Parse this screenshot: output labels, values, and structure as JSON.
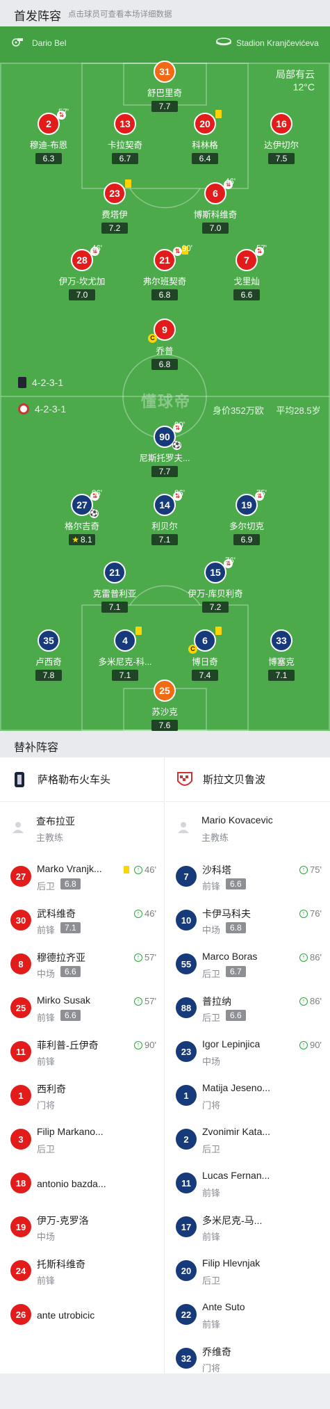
{
  "header": {
    "title": "首发阵容",
    "subtitle": "点击球员可查看本场详细数据"
  },
  "match": {
    "referee": "Dario Bel",
    "stadium": "Stadion Kranjčevićeva",
    "weather": "局部有云",
    "temperature": "12°C"
  },
  "home": {
    "formation": "4-2-3-1",
    "players": [
      {
        "num": "31",
        "name": "舒巴里奇",
        "rating": "7.7",
        "color": "orange"
      },
      {
        "num": "2",
        "name": "穆迪-布恩",
        "rating": "6.3",
        "color": "red",
        "sub_min": "57'"
      },
      {
        "num": "13",
        "name": "卡拉契奇",
        "rating": "6.7",
        "color": "red"
      },
      {
        "num": "20",
        "name": "科林格",
        "rating": "6.4",
        "color": "red"
      },
      {
        "num": "16",
        "name": "达伊切尔",
        "rating": "7.5",
        "color": "red"
      },
      {
        "num": "23",
        "name": "费塔伊",
        "rating": "7.2",
        "color": "red"
      },
      {
        "num": "6",
        "name": "博斯科维奇",
        "rating": "7.0",
        "color": "red",
        "sub_min": "46'"
      },
      {
        "num": "28",
        "name": "伊万-坎尤加",
        "rating": "7.0",
        "color": "red",
        "sub_min": "46'"
      },
      {
        "num": "21",
        "name": "弗尔班契奇",
        "rating": "6.8",
        "color": "red",
        "sub_min": "90'"
      },
      {
        "num": "7",
        "name": "戈里灿",
        "rating": "6.6",
        "color": "red",
        "sub_min": "57'"
      },
      {
        "num": "9",
        "name": "乔普",
        "rating": "6.8",
        "color": "red",
        "captain": "C"
      }
    ]
  },
  "away": {
    "formation": "4-2-3-1",
    "market_value": "身价352万欧",
    "avg_age": "平均28.5岁",
    "players": [
      {
        "num": "90",
        "name": "尼斯托罗夫...",
        "rating": "7.7",
        "color": "navy",
        "sub_min": "90'"
      },
      {
        "num": "27",
        "name": "格尔吉奇",
        "rating": "8.1",
        "color": "navy",
        "sub_min": "86'",
        "star": "★"
      },
      {
        "num": "14",
        "name": "利贝尔",
        "rating": "7.1",
        "color": "navy",
        "sub_min": "86'"
      },
      {
        "num": "19",
        "name": "多尔切克",
        "rating": "6.9",
        "color": "navy",
        "sub_min": "75'"
      },
      {
        "num": "21",
        "name": "克雷普利亚",
        "rating": "7.1",
        "color": "navy"
      },
      {
        "num": "15",
        "name": "伊万-库贝利奇",
        "rating": "7.2",
        "color": "navy",
        "sub_min": "76'"
      },
      {
        "num": "35",
        "name": "卢西奇",
        "rating": "7.8",
        "color": "navy"
      },
      {
        "num": "4",
        "name": "多米尼克-科...",
        "rating": "7.1",
        "color": "navy"
      },
      {
        "num": "6",
        "name": "博日奇",
        "rating": "7.4",
        "color": "navy",
        "captain": "C"
      },
      {
        "num": "33",
        "name": "博塞克",
        "rating": "7.1",
        "color": "navy"
      },
      {
        "num": "25",
        "name": "苏沙克",
        "rating": "7.6",
        "color": "orange"
      }
    ]
  },
  "watermark": "懂球帝",
  "subs_title": "替补阵容",
  "subs": {
    "left": {
      "team": "萨格勒布火车头",
      "coach": {
        "name": "查布拉亚",
        "role": "主教练"
      },
      "items": [
        {
          "num": "27",
          "name": "Marko Vranjk...",
          "pos": "后卫",
          "rating": "6.8",
          "min": "46'",
          "ycard": true
        },
        {
          "num": "30",
          "name": "武科维奇",
          "pos": "前锋",
          "rating": "7.1",
          "min": "46'"
        },
        {
          "num": "8",
          "name": "穆德拉齐亚",
          "pos": "中场",
          "rating": "6.6",
          "min": "57'"
        },
        {
          "num": "25",
          "name": "Mirko Susak",
          "pos": "前锋",
          "rating": "6.6",
          "min": "57'"
        },
        {
          "num": "11",
          "name": "菲利普-丘伊奇",
          "pos": "前锋",
          "rating": "",
          "min": "90'"
        },
        {
          "num": "1",
          "name": "西利奇",
          "pos": "门将",
          "rating": "",
          "min": ""
        },
        {
          "num": "3",
          "name": "Filip Markano...",
          "pos": "后卫",
          "rating": "",
          "min": ""
        },
        {
          "num": "18",
          "name": "antonio bazda...",
          "pos": "",
          "rating": "",
          "min": ""
        },
        {
          "num": "19",
          "name": "伊万-克罗洛",
          "pos": "中场",
          "rating": "",
          "min": ""
        },
        {
          "num": "24",
          "name": "托斯科维奇",
          "pos": "前锋",
          "rating": "",
          "min": ""
        },
        {
          "num": "26",
          "name": "ante utrobicic",
          "pos": "",
          "rating": "",
          "min": ""
        }
      ]
    },
    "right": {
      "team": "斯拉文贝鲁波",
      "coach": {
        "name": "Mario Kovacevic",
        "role": "主教练"
      },
      "items": [
        {
          "num": "7",
          "name": "沙科塔",
          "pos": "前锋",
          "rating": "6.6",
          "min": "75'"
        },
        {
          "num": "10",
          "name": "卡伊马科夫",
          "pos": "中场",
          "rating": "6.8",
          "min": "76'"
        },
        {
          "num": "55",
          "name": "Marco Boras",
          "pos": "后卫",
          "rating": "6.7",
          "min": "86'"
        },
        {
          "num": "88",
          "name": "普拉纳",
          "pos": "后卫",
          "rating": "6.6",
          "min": "86'"
        },
        {
          "num": "23",
          "name": "Igor Lepinjica",
          "pos": "中场",
          "rating": "",
          "min": "90'"
        },
        {
          "num": "1",
          "name": "Matija Jeseno...",
          "pos": "门将",
          "rating": "",
          "min": ""
        },
        {
          "num": "2",
          "name": "Zvonimir Kata...",
          "pos": "后卫",
          "rating": "",
          "min": ""
        },
        {
          "num": "11",
          "name": "Lucas Fernan...",
          "pos": "前锋",
          "rating": "",
          "min": ""
        },
        {
          "num": "17",
          "name": "多米尼克-马...",
          "pos": "前锋",
          "rating": "",
          "min": ""
        },
        {
          "num": "20",
          "name": "Filip Hlevnjak",
          "pos": "后卫",
          "rating": "",
          "min": ""
        },
        {
          "num": "22",
          "name": "Ante Suto",
          "pos": "前锋",
          "rating": "",
          "min": ""
        },
        {
          "num": "32",
          "name": "乔维奇",
          "pos": "门将",
          "rating": "",
          "min": ""
        }
      ]
    }
  }
}
